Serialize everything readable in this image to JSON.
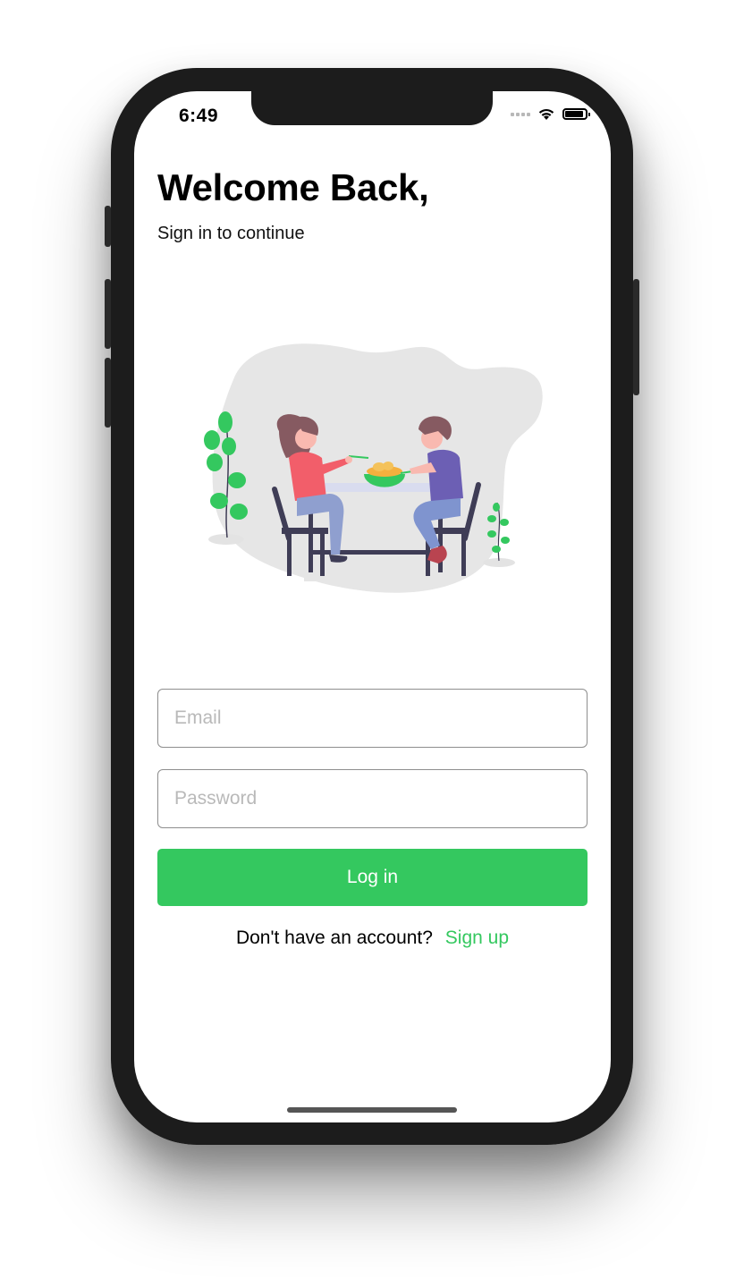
{
  "status_bar": {
    "time": "6:49",
    "icons": [
      "cellular-signal-icon",
      "wifi-icon",
      "battery-icon"
    ]
  },
  "header": {
    "title": "Welcome Back,",
    "subtitle": "Sign in to continue"
  },
  "illustration": {
    "description_icon": "couple-eating-illustration"
  },
  "form": {
    "email_placeholder": "Email",
    "email_value": "",
    "password_placeholder": "Password",
    "password_value": "",
    "login_label": "Log in"
  },
  "footer": {
    "question": "Don't have an account?",
    "signup_label": "Sign up"
  },
  "colors": {
    "accent": "#34c85f",
    "frame": "#1c1c1c",
    "placeholder": "#b9b9b9",
    "text": "#000000"
  }
}
